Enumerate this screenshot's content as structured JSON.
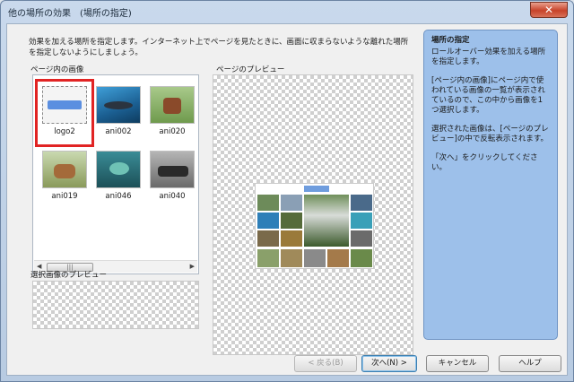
{
  "window": {
    "title": "他の場所の効果　(場所の指定)",
    "close_label": "✕"
  },
  "instructions": "効果を加える場所を指定します。インターネット上でページを見たときに、画面に収まらないような離れた場所を指定しないようにしましょう。",
  "image_list": {
    "label": "ページ内の画像",
    "selected_index": 0,
    "items": [
      {
        "name": "logo2"
      },
      {
        "name": "ani002"
      },
      {
        "name": "ani020"
      },
      {
        "name": "ani019"
      },
      {
        "name": "ani046"
      },
      {
        "name": "ani040"
      }
    ],
    "scroll_left": "◀",
    "scroll_right": "▶",
    "scroll_grip": "|||"
  },
  "page_preview": {
    "label": "ページのプレビュー"
  },
  "selected_preview": {
    "label": "選択画像のプレビュー"
  },
  "help": {
    "title": "場所の指定",
    "paragraphs": [
      "ロールオーバー効果を加える場所を指定します。",
      "[ページ内の画像]にページ内で使われている画像の一覧が表示されているので、この中から画像を1つ選択します。",
      "選択された画像は、[ページのプレビュー]の中で反転表示されます。",
      "「次へ」をクリックしてください。"
    ]
  },
  "buttons": {
    "back": "< 戻る(B)",
    "next": "次へ(N) >",
    "cancel": "キャンセル",
    "help": "ヘルプ"
  },
  "colors": {
    "selection_outline": "#e12424",
    "help_panel": "#9dc0ea"
  }
}
